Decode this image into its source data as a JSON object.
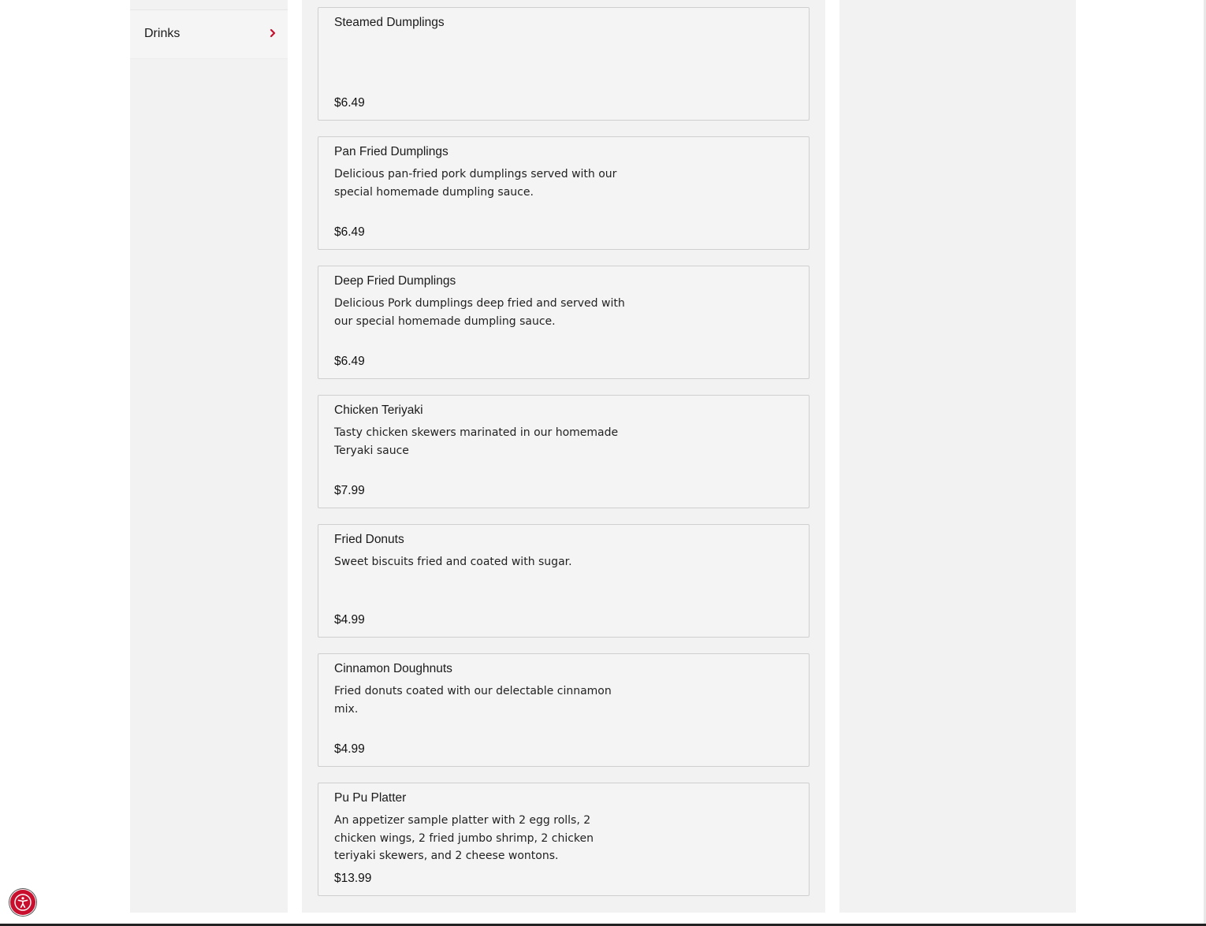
{
  "sidebar": {
    "items": [
      {
        "label": "Drinks",
        "icon": "chevron-right-icon"
      }
    ]
  },
  "menu": {
    "items": [
      {
        "name": "Steamed Dumplings",
        "description": "",
        "price": "$6.49"
      },
      {
        "name": "Pan Fried Dumplings",
        "description": "Delicious pan-fried pork dumplings served with our special homemade dumpling sauce.",
        "price": "$6.49"
      },
      {
        "name": "Deep Fried Dumplings",
        "description": "Delicious Pork dumplings deep fried and served with our special homemade dumpling sauce.",
        "price": "$6.49"
      },
      {
        "name": "Chicken Teriyaki",
        "description": "Tasty chicken skewers marinated in our homemade Teryaki sauce",
        "price": "$7.99"
      },
      {
        "name": "Fried Donuts",
        "description": "Sweet biscuits fried and coated with sugar.",
        "price": "$4.99"
      },
      {
        "name": "Cinnamon Doughnuts",
        "description": "Fried donuts coated with our delectable cinnamon mix.",
        "price": "$4.99"
      },
      {
        "name": "Pu Pu Platter",
        "description": "An appetizer sample platter with 2 egg rolls, 2 chicken wings, 2 fried jumbo shrimp, 2 chicken teriyaki skewers, and 2 cheese wontons.",
        "price": "$13.99"
      }
    ]
  },
  "accessibility": {
    "icon": "accessibility-icon"
  },
  "colors": {
    "accent": "#c8102e",
    "panel_background": "#f2f2f2",
    "card_border": "#cfcfcf"
  }
}
